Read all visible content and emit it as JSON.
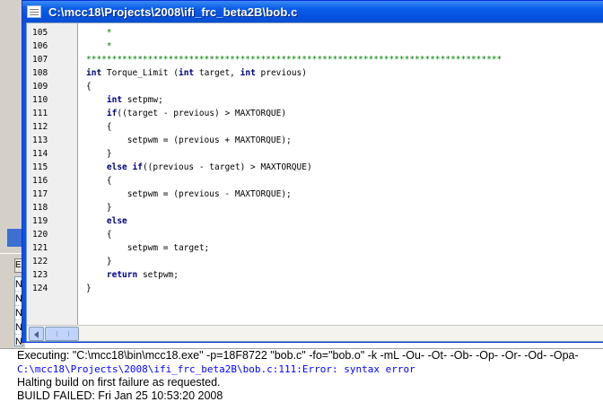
{
  "window": {
    "title": "C:\\mcc18\\Projects\\2008\\ifi_frc_beta2B\\bob.c"
  },
  "background_panel": {
    "tab_label": "E",
    "list_items": [
      "N",
      "N",
      "N",
      "N",
      "N"
    ]
  },
  "editor": {
    "lines": [
      {
        "num": "105",
        "segments": [
          {
            "t": "    *",
            "c": "comment"
          }
        ]
      },
      {
        "num": "106",
        "segments": [
          {
            "t": "    *",
            "c": "comment"
          }
        ]
      },
      {
        "num": "107",
        "segments": [
          {
            "t": "*********************************************************************************",
            "c": "comment"
          }
        ]
      },
      {
        "num": "108",
        "segments": [
          {
            "t": "int",
            "c": "keyword"
          },
          {
            "t": " Torque_Limit (",
            "c": "plain"
          },
          {
            "t": "int",
            "c": "keyword"
          },
          {
            "t": " target, ",
            "c": "plain"
          },
          {
            "t": "int",
            "c": "keyword"
          },
          {
            "t": " previous)",
            "c": "plain"
          }
        ]
      },
      {
        "num": "109",
        "segments": [
          {
            "t": "{",
            "c": "plain"
          }
        ]
      },
      {
        "num": "110",
        "segments": [
          {
            "t": "    ",
            "c": "plain"
          },
          {
            "t": "int",
            "c": "keyword"
          },
          {
            "t": " setpmw;",
            "c": "plain"
          }
        ]
      },
      {
        "num": "111",
        "segments": [
          {
            "t": "    ",
            "c": "plain"
          },
          {
            "t": "if",
            "c": "keyword"
          },
          {
            "t": "((target - previous) > MAXTORQUE)",
            "c": "plain"
          }
        ]
      },
      {
        "num": "112",
        "segments": [
          {
            "t": "    {",
            "c": "plain"
          }
        ]
      },
      {
        "num": "113",
        "segments": [
          {
            "t": "        setpwm = (previous + MAXTORQUE);",
            "c": "plain"
          }
        ]
      },
      {
        "num": "114",
        "segments": [
          {
            "t": "    }",
            "c": "plain"
          }
        ]
      },
      {
        "num": "115",
        "segments": [
          {
            "t": "    ",
            "c": "plain"
          },
          {
            "t": "else if",
            "c": "keyword"
          },
          {
            "t": "((previous - target) > MAXTORQUE)",
            "c": "plain"
          }
        ]
      },
      {
        "num": "116",
        "segments": [
          {
            "t": "    {",
            "c": "plain"
          }
        ]
      },
      {
        "num": "117",
        "segments": [
          {
            "t": "        setpwm = (previous - MAXTORQUE);",
            "c": "plain"
          }
        ]
      },
      {
        "num": "118",
        "segments": [
          {
            "t": "    }",
            "c": "plain"
          }
        ]
      },
      {
        "num": "119",
        "segments": [
          {
            "t": "    ",
            "c": "plain"
          },
          {
            "t": "else",
            "c": "keyword"
          }
        ]
      },
      {
        "num": "120",
        "segments": [
          {
            "t": "    {",
            "c": "plain"
          }
        ]
      },
      {
        "num": "121",
        "segments": [
          {
            "t": "        setpwm = target;",
            "c": "plain"
          }
        ]
      },
      {
        "num": "122",
        "segments": [
          {
            "t": "    }",
            "c": "plain"
          }
        ]
      },
      {
        "num": "123",
        "segments": [
          {
            "t": "    ",
            "c": "plain"
          },
          {
            "t": "return",
            "c": "keyword"
          },
          {
            "t": " setpwm;",
            "c": "plain"
          }
        ]
      },
      {
        "num": "124",
        "segments": [
          {
            "t": "}",
            "c": "plain"
          }
        ]
      }
    ]
  },
  "output": {
    "executing": "Executing: \"C:\\mcc18\\bin\\mcc18.exe\" -p=18F8722 \"bob.c\" -fo=\"bob.o\" -k -mL -Ou- -Ot- -Ob- -Op- -Or- -Od- -Opa-",
    "error": "C:\\mcc18\\Projects\\2008\\ifi_frc_beta2B\\bob.c:111:Error: syntax error",
    "halting": "Halting build on first failure as requested.",
    "build_failed": "BUILD FAILED: Fri Jan 25 10:53:20 2008"
  },
  "colors": {
    "titlebar": "#0a5ee8",
    "comment": "#008000",
    "keyword": "#000080",
    "error_text": "#0000ff"
  },
  "icons": {
    "title_icon": "document-icon",
    "scroll_left": "chevron-left-icon"
  }
}
